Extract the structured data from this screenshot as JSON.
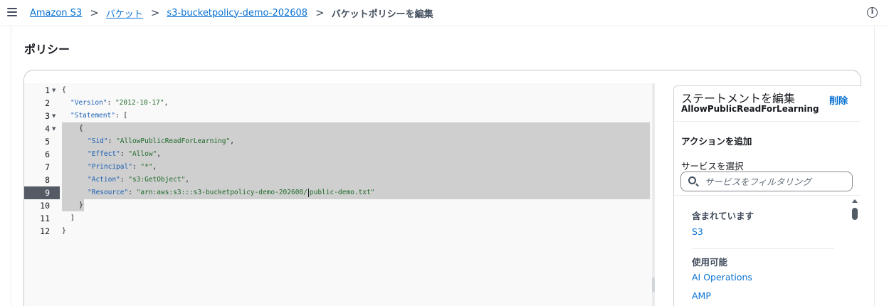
{
  "breadcrumbs": {
    "items": [
      "Amazon S3",
      "バケット",
      "s3-bucketpolicy-demo-202608"
    ],
    "current": "バケットポリシーを編集",
    "separator": ">"
  },
  "info_icon": "i",
  "section": {
    "title": "ポリシー"
  },
  "editor": {
    "line_numbers": [
      "1",
      "2",
      "3",
      "4",
      "5",
      "6",
      "7",
      "8",
      "9",
      "10",
      "11",
      "12"
    ],
    "active_line": "9",
    "lines": {
      "l1": {
        "punct": "{"
      },
      "l2": {
        "key": "\"Version\"",
        "colon": ": ",
        "value": "\"2012-10-17\"",
        "tail": ","
      },
      "l3": {
        "key": "\"Statement\"",
        "colon": ": ["
      },
      "l4": {
        "punct": "{"
      },
      "l5": {
        "key": "\"Sid\"",
        "colon": ": ",
        "value": "\"AllowPublicReadForLearning\"",
        "tail": ","
      },
      "l6": {
        "key": "\"Effect\"",
        "colon": ": ",
        "value": "\"Allow\"",
        "tail": ","
      },
      "l7": {
        "key": "\"Principal\"",
        "colon": ": ",
        "value": "\"*\"",
        "tail": ","
      },
      "l8": {
        "key": "\"Action\"",
        "colon": ": ",
        "value": "\"s3:GetObject\"",
        "tail": ","
      },
      "l9": {
        "key": "\"Resource\"",
        "colon": ": ",
        "value_a": "\"arn:aws:s3:::s3-bucketpolicy-demo-202608/",
        "value_b": "public-demo.txt\""
      },
      "l10": {
        "punct": "}"
      },
      "l11": {
        "punct": "]"
      },
      "l12": {
        "punct": "}"
      }
    }
  },
  "statement_panel": {
    "title": "ステートメントを編集",
    "sid": "AllowPublicReadForLearning",
    "delete_label": "削除",
    "add_action_label": "アクションを追加",
    "service_label": "サービスを選択",
    "search_placeholder": "サービスをフィルタリング",
    "included_label": "含まれています",
    "included_items": [
      "S3"
    ],
    "available_label": "使用可能",
    "available_items": [
      "AI Operations",
      "AMP"
    ]
  },
  "colors": {
    "link": "#0972d3",
    "text": "#16191f",
    "json_key": "#1a5fb4",
    "json_string": "#1f6c2a",
    "selection": "#cfcfcf",
    "active_gutter": "#545b64"
  }
}
